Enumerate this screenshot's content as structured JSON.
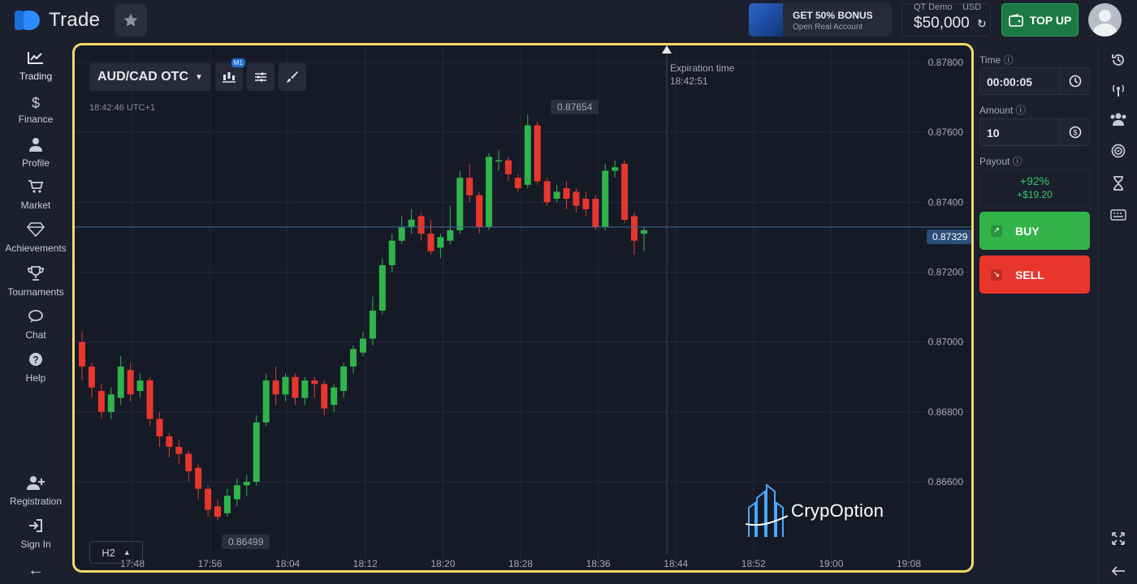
{
  "brand": {
    "name": "Trade"
  },
  "header": {
    "bonus_title": "GET 50% BONUS",
    "bonus_sub": "Open Real Account",
    "account_type": "QT Demo",
    "currency": "USD",
    "balance": "$50,000",
    "topup_label": "TOP UP"
  },
  "sidebar": {
    "items": [
      {
        "label": "Trading",
        "icon": "chart-line-icon"
      },
      {
        "label": "Finance",
        "icon": "dollar-icon"
      },
      {
        "label": "Profile",
        "icon": "user-icon"
      },
      {
        "label": "Market",
        "icon": "cart-icon"
      },
      {
        "label": "Achievements",
        "icon": "diamond-icon"
      },
      {
        "label": "Tournaments",
        "icon": "trophy-icon"
      },
      {
        "label": "Chat",
        "icon": "chat-icon"
      },
      {
        "label": "Help",
        "icon": "help-icon"
      }
    ],
    "bottom_items": [
      {
        "label": "Registration",
        "icon": "user-plus-icon"
      },
      {
        "label": "Sign In",
        "icon": "sign-in-icon"
      }
    ]
  },
  "chart": {
    "pair": "AUD/CAD OTC",
    "timeframe_badge": "M1",
    "clock": "18:42:46 UTC+1",
    "period": "H2",
    "expiration_label": "Expiration time",
    "expiration_time": "18:42:51",
    "high_label": "0.87654",
    "low_label": "0.86499",
    "current_price": "0.87329",
    "watermark": "CrypOption"
  },
  "chart_data": {
    "type": "candlestick",
    "y_axis": [
      "0.87800",
      "0.87600",
      "0.87400",
      "0.87200",
      "0.87000",
      "0.86800",
      "0.86600"
    ],
    "x_axis": [
      "17:48",
      "17:56",
      "18:04",
      "18:12",
      "18:20",
      "18:28",
      "18:36",
      "18:44",
      "18:52",
      "19:00",
      "19:08"
    ],
    "candles": [
      [
        0.87,
        0.8693,
        0.8703,
        0.8689
      ],
      [
        0.8693,
        0.8687,
        0.8694,
        0.8684
      ],
      [
        0.8686,
        0.868,
        0.8688,
        0.8678
      ],
      [
        0.868,
        0.8685,
        0.8687,
        0.8678
      ],
      [
        0.8684,
        0.8693,
        0.8696,
        0.8682
      ],
      [
        0.8692,
        0.8685,
        0.8694,
        0.8683
      ],
      [
        0.8686,
        0.8689,
        0.8691,
        0.8684
      ],
      [
        0.8689,
        0.8678,
        0.869,
        0.8676
      ],
      [
        0.8678,
        0.8673,
        0.868,
        0.867
      ],
      [
        0.8673,
        0.867,
        0.8674,
        0.8667
      ],
      [
        0.867,
        0.8668,
        0.8672,
        0.8665
      ],
      [
        0.8668,
        0.8663,
        0.8669,
        0.866
      ],
      [
        0.8664,
        0.8658,
        0.8665,
        0.8655
      ],
      [
        0.8658,
        0.8652,
        0.8659,
        0.865
      ],
      [
        0.8653,
        0.865,
        0.8655,
        0.8649
      ],
      [
        0.8651,
        0.8656,
        0.8658,
        0.865
      ],
      [
        0.8655,
        0.8659,
        0.8661,
        0.8653
      ],
      [
        0.8659,
        0.866,
        0.8662,
        0.8656
      ],
      [
        0.866,
        0.8677,
        0.8679,
        0.8659
      ],
      [
        0.8677,
        0.8689,
        0.8691,
        0.8676
      ],
      [
        0.8689,
        0.8685,
        0.8693,
        0.8682
      ],
      [
        0.8685,
        0.869,
        0.8691,
        0.8683
      ],
      [
        0.869,
        0.8684,
        0.8691,
        0.8682
      ],
      [
        0.8684,
        0.8689,
        0.869,
        0.8682
      ],
      [
        0.8689,
        0.8688,
        0.869,
        0.8684
      ],
      [
        0.8688,
        0.8681,
        0.8689,
        0.8679
      ],
      [
        0.8682,
        0.8687,
        0.8688,
        0.868
      ],
      [
        0.8686,
        0.8693,
        0.8694,
        0.8684
      ],
      [
        0.8693,
        0.8698,
        0.8699,
        0.8691
      ],
      [
        0.8697,
        0.8701,
        0.8703,
        0.8696
      ],
      [
        0.8701,
        0.8709,
        0.8713,
        0.8699
      ],
      [
        0.8709,
        0.8722,
        0.8724,
        0.8708
      ],
      [
        0.8722,
        0.8729,
        0.8731,
        0.872
      ],
      [
        0.8729,
        0.8733,
        0.8736,
        0.8728
      ],
      [
        0.8733,
        0.8735,
        0.8738,
        0.8731
      ],
      [
        0.8736,
        0.8731,
        0.8737,
        0.8729
      ],
      [
        0.8731,
        0.8726,
        0.8735,
        0.8725
      ],
      [
        0.8727,
        0.873,
        0.8731,
        0.8724
      ],
      [
        0.8729,
        0.8732,
        0.8739,
        0.8728
      ],
      [
        0.8732,
        0.8747,
        0.8749,
        0.8731
      ],
      [
        0.8747,
        0.8742,
        0.8751,
        0.874
      ],
      [
        0.8742,
        0.8733,
        0.8743,
        0.8731
      ],
      [
        0.8733,
        0.8753,
        0.8754,
        0.8732
      ],
      [
        0.8752,
        0.8752,
        0.8755,
        0.8749
      ],
      [
        0.8752,
        0.8748,
        0.8753,
        0.8746
      ],
      [
        0.8747,
        0.8744,
        0.8748,
        0.8743
      ],
      [
        0.8745,
        0.8762,
        0.8765,
        0.8744
      ],
      [
        0.8762,
        0.8746,
        0.8763,
        0.8745
      ],
      [
        0.8746,
        0.874,
        0.8747,
        0.8739
      ],
      [
        0.8741,
        0.8743,
        0.8745,
        0.874
      ],
      [
        0.8744,
        0.8741,
        0.8746,
        0.8738
      ],
      [
        0.8743,
        0.8739,
        0.8744,
        0.8737
      ],
      [
        0.8741,
        0.8738,
        0.8743,
        0.8736
      ],
      [
        0.8741,
        0.8733,
        0.8742,
        0.8732
      ],
      [
        0.8733,
        0.8749,
        0.8751,
        0.8732
      ],
      [
        0.8749,
        0.875,
        0.8752,
        0.8747
      ],
      [
        0.8751,
        0.8735,
        0.8752,
        0.8734
      ],
      [
        0.8736,
        0.8729,
        0.8737,
        0.8725
      ],
      [
        0.8731,
        0.8732,
        0.8733,
        0.8726
      ]
    ]
  },
  "panel": {
    "time_label": "Time",
    "time_value": "00:00:05",
    "amount_label": "Amount",
    "amount_value": "10",
    "payout_label": "Payout",
    "payout_pct": "+92%",
    "payout_amt": "+$19.20",
    "buy_label": "BUY",
    "sell_label": "SELL"
  },
  "colors": {
    "up": "#2fb54a",
    "down": "#e8362d",
    "frame_highlight": "#f5d86a",
    "accent": "#1f6fd1"
  }
}
